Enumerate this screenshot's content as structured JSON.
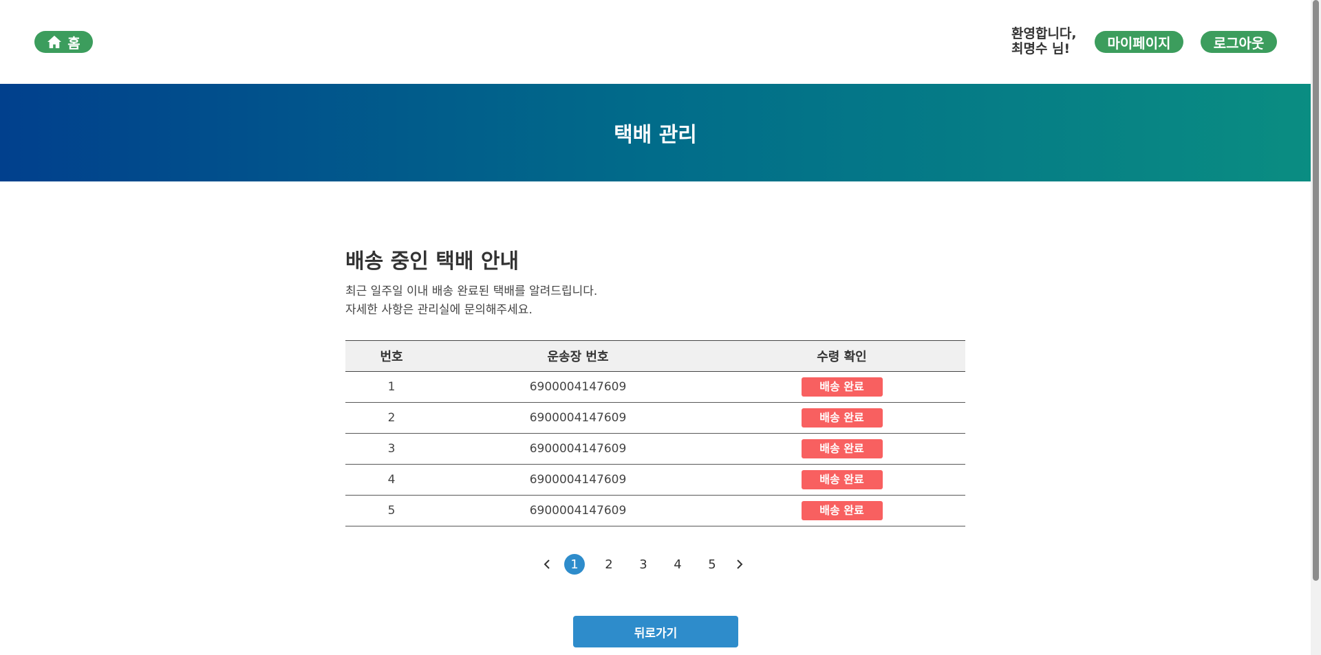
{
  "header": {
    "home_label": "홈",
    "welcome_line1": "환영합니다,",
    "welcome_line2": "최명수 님!",
    "mypage_label": "마이페이지",
    "logout_label": "로그아웃"
  },
  "banner": {
    "title": "택배 관리"
  },
  "main": {
    "title": "배송 중인 택배 안내",
    "desc_line1": "최근 일주일 이내 배송 완료된 택배를 알려드립니다.",
    "desc_line2": "자세한 사항은 관리실에 문의해주세요."
  },
  "table": {
    "headers": [
      "번호",
      "운송장 번호",
      "수령 확인"
    ],
    "rows": [
      {
        "num": "1",
        "tracking": "6900004147609",
        "status": "배송 완료"
      },
      {
        "num": "2",
        "tracking": "6900004147609",
        "status": "배송 완료"
      },
      {
        "num": "3",
        "tracking": "6900004147609",
        "status": "배송 완료"
      },
      {
        "num": "4",
        "tracking": "6900004147609",
        "status": "배송 완료"
      },
      {
        "num": "5",
        "tracking": "6900004147609",
        "status": "배송 완료"
      }
    ]
  },
  "pagination": {
    "pages": [
      "1",
      "2",
      "3",
      "4",
      "5"
    ],
    "current": "1",
    "prev_icon": "chevron-left-icon",
    "next_icon": "chevron-right-icon"
  },
  "back_label": "뒤로가기",
  "colors": {
    "green": "#3c9d5d",
    "blue": "#2e8ccb",
    "badge_red": "#f86060",
    "banner_start": "#01408d",
    "banner_end": "#0a8d82"
  }
}
